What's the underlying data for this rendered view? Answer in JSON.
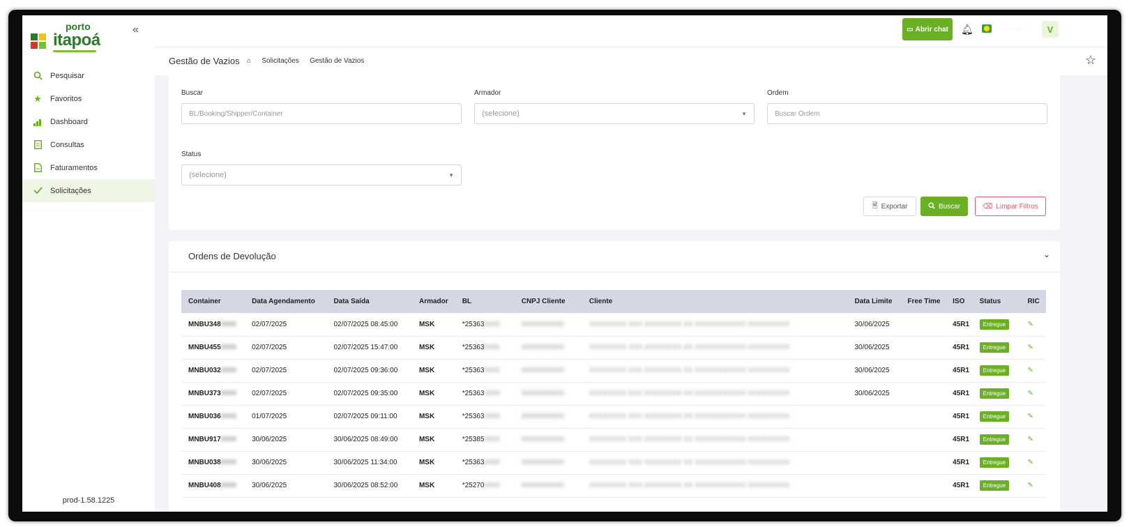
{
  "brand": {
    "line1": "porto",
    "line2": "itapoá"
  },
  "sidebar": {
    "items": [
      {
        "label": "Pesquisar",
        "icon": "search-icon"
      },
      {
        "label": "Favoritos",
        "icon": "star-icon"
      },
      {
        "label": "Dashboard",
        "icon": "chart-icon"
      },
      {
        "label": "Consultas",
        "icon": "document-icon"
      },
      {
        "label": "Faturamentos",
        "icon": "invoice-icon"
      },
      {
        "label": "Solicitações",
        "icon": "check-icon"
      }
    ],
    "version": "prod-1.58.1225"
  },
  "topbar": {
    "chat_label": "Abrir chat",
    "username": "··· ·······",
    "avatar_letter": "V"
  },
  "breadcrumb": {
    "title": "Gestão de Vazios",
    "items": [
      "Solicitações",
      "Gestão de Vazios"
    ]
  },
  "filters": {
    "buscar": {
      "label": "Buscar",
      "placeholder": "BL/Booking/Shipper/Container"
    },
    "armador": {
      "label": "Armador",
      "placeholder": "(selecione)"
    },
    "ordem": {
      "label": "Ordem",
      "placeholder": "Buscar Ordem"
    },
    "status": {
      "label": "Status",
      "placeholder": "(selecione)"
    },
    "export_label": "Exportar",
    "search_label": "Buscar",
    "clear_label": "Limpar Filtros"
  },
  "orders": {
    "title": "Ordens de Devolução",
    "columns": [
      "Container",
      "Data Agendamento",
      "Data Saída",
      "Armador",
      "BL",
      "CNPJ Cliente",
      "Cliente",
      "Data Limite",
      "Free Time",
      "ISO",
      "Status",
      "RIC"
    ],
    "rows": [
      {
        "container": "MNBU348",
        "agendamento": "02/07/2025",
        "saida": "02/07/2025 08:45:00",
        "armador": "MSK",
        "bl": "*25363",
        "limite": "30/06/2025",
        "iso": "45R1",
        "status": "Entregue"
      },
      {
        "container": "MNBU455",
        "agendamento": "02/07/2025",
        "saida": "02/07/2025 15:47:00",
        "armador": "MSK",
        "bl": "*25363",
        "limite": "30/06/2025",
        "iso": "45R1",
        "status": "Entregue"
      },
      {
        "container": "MNBU032",
        "agendamento": "02/07/2025",
        "saida": "02/07/2025 09:36:00",
        "armador": "MSK",
        "bl": "*25363",
        "limite": "30/06/2025",
        "iso": "45R1",
        "status": "Entregue"
      },
      {
        "container": "MNBU373",
        "agendamento": "02/07/2025",
        "saida": "02/07/2025 09:35:00",
        "armador": "MSK",
        "bl": "*25363",
        "limite": "30/06/2025",
        "iso": "45R1",
        "status": "Entregue"
      },
      {
        "container": "MNBU036",
        "agendamento": "01/07/2025",
        "saida": "02/07/2025 09:11:00",
        "armador": "MSK",
        "bl": "*25363",
        "limite": "",
        "iso": "45R1",
        "status": "Entregue"
      },
      {
        "container": "MNBU917",
        "agendamento": "30/06/2025",
        "saida": "30/06/2025 08:49:00",
        "armador": "MSK",
        "bl": "*25385",
        "limite": "",
        "iso": "45R1",
        "status": "Entregue"
      },
      {
        "container": "MNBU038",
        "agendamento": "30/06/2025",
        "saida": "30/06/2025 11:34:00",
        "armador": "MSK",
        "bl": "*25363",
        "limite": "",
        "iso": "45R1",
        "status": "Entregue"
      },
      {
        "container": "MNBU408",
        "agendamento": "30/06/2025",
        "saida": "30/06/2025 08:52:00",
        "armador": "MSK",
        "bl": "*25270",
        "limite": "",
        "iso": "45R1",
        "status": "Entregue"
      }
    ]
  },
  "colors": {
    "accent": "#6ab023",
    "danger": "#e05565",
    "header_bg": "#d4d8e4"
  }
}
